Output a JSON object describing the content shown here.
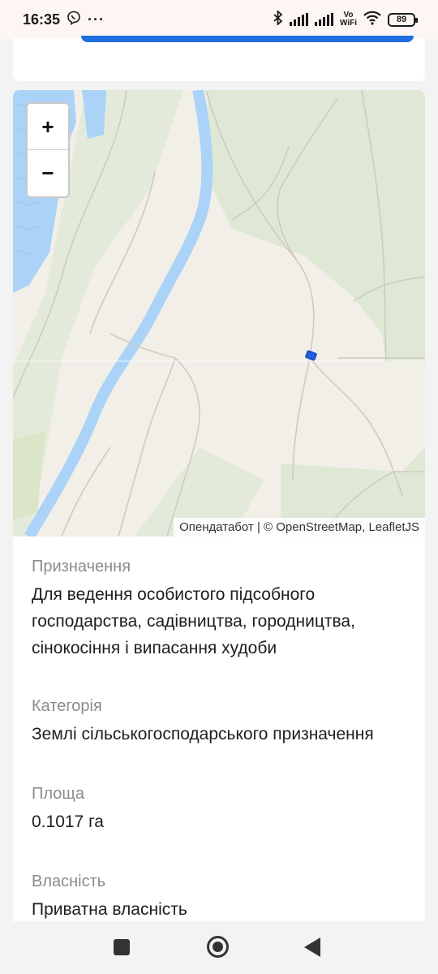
{
  "status_bar": {
    "time": "16:35",
    "more": "···",
    "vo_wifi_top": "Vo",
    "vo_wifi_bottom": "WiFi",
    "battery": "89"
  },
  "map": {
    "zoom_in": "+",
    "zoom_out": "−",
    "attribution": "Опендатабот | © OpenStreetMap, LeafletJS"
  },
  "details": {
    "fields": [
      {
        "label": "Призначення",
        "value": "Для ведення особистого підсобного господарства, садівництва, городництва, сінокосіння і випасання худоби"
      },
      {
        "label": "Категорія",
        "value": "Землі сільськогосподарського призначення"
      },
      {
        "label": "Площа",
        "value": "0.1017 га"
      },
      {
        "label": "Власність",
        "value": "Приватна власність"
      }
    ]
  },
  "colors": {
    "accent": "#1f6fe0",
    "water": "#aad3f7",
    "forest": "#dfe8d5",
    "land": "#f2efe9"
  }
}
